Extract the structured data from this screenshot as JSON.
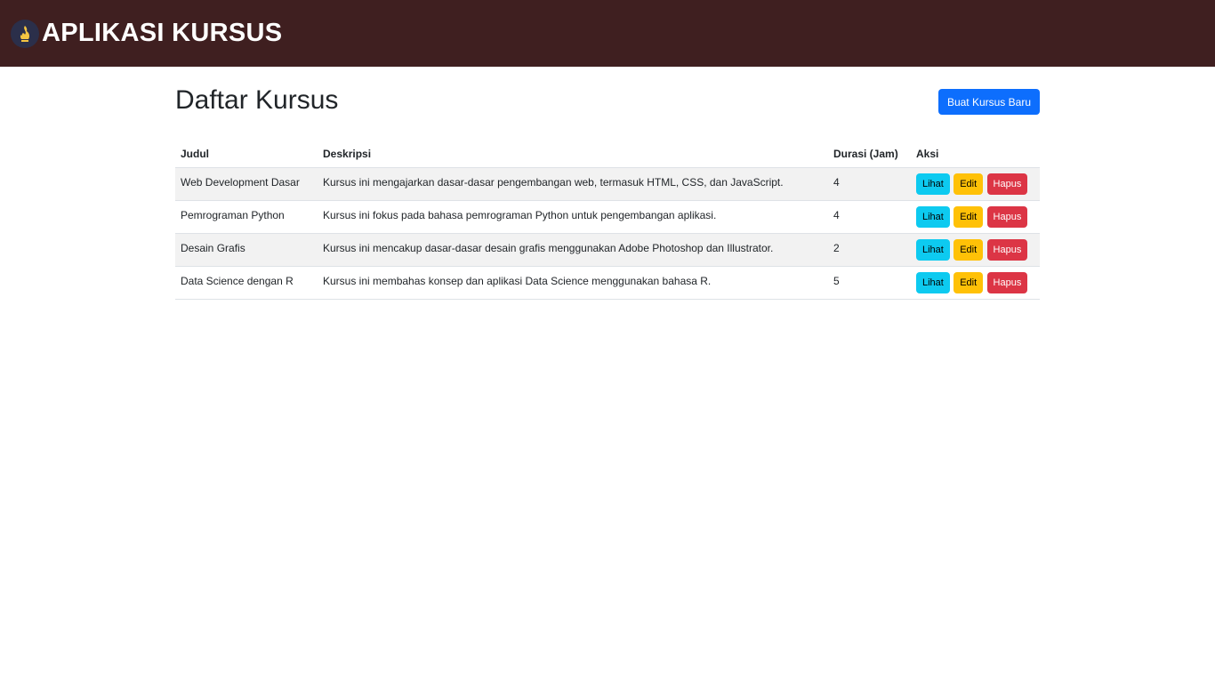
{
  "navbar": {
    "brand": "APLIKASI KURSUS",
    "logo_icon": "flame-icon"
  },
  "page": {
    "title": "Daftar Kursus",
    "create_button": "Buat Kursus Baru"
  },
  "table": {
    "headers": [
      "Judul",
      "Deskripsi",
      "Durasi (Jam)",
      "Aksi"
    ],
    "rows": [
      {
        "judul": "Web Development Dasar",
        "deskripsi": "Kursus ini mengajarkan dasar-dasar pengembangan web, termasuk HTML, CSS, dan JavaScript.",
        "durasi": "4"
      },
      {
        "judul": "Pemrograman Python",
        "deskripsi": "Kursus ini fokus pada bahasa pemrograman Python untuk pengembangan aplikasi.",
        "durasi": "4"
      },
      {
        "judul": "Desain Grafis",
        "deskripsi": "Kursus ini mencakup dasar-dasar desain grafis menggunakan Adobe Photoshop dan Illustrator.",
        "durasi": "2"
      },
      {
        "judul": "Data Science dengan R",
        "deskripsi": "Kursus ini membahas konsep dan aplikasi Data Science menggunakan bahasa R.",
        "durasi": "5"
      }
    ],
    "actions": {
      "view": "Lihat",
      "edit": "Edit",
      "delete": "Hapus"
    }
  },
  "colors": {
    "navbar": "#3f1f20",
    "primary": "#0d6efd",
    "info": "#0dcaf0",
    "warning": "#ffc107",
    "danger": "#dc3545"
  }
}
